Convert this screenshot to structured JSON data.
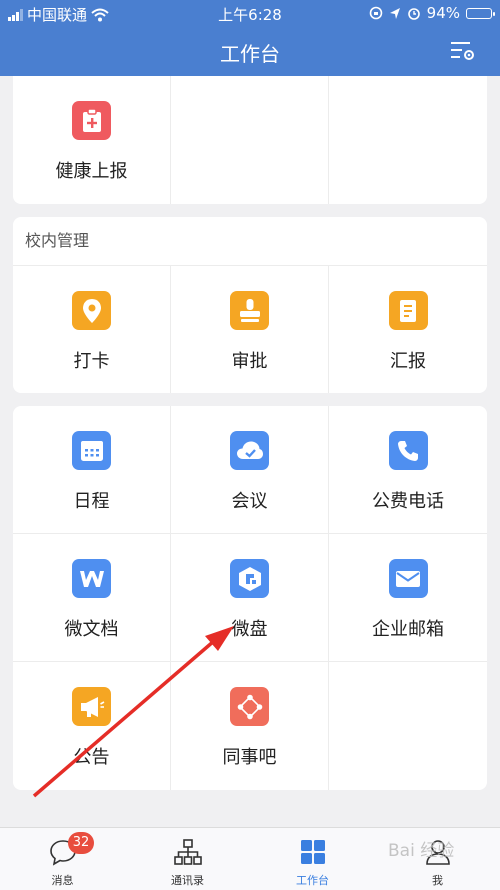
{
  "status_bar": {
    "carrier": "中国联通",
    "time": "上午6:28",
    "battery": "94%",
    "battery_level": 0.94
  },
  "nav": {
    "title": "工作台",
    "settings_icon": "list-settings-icon"
  },
  "section_top": {
    "items": [
      {
        "label": "健康上报",
        "icon": "clipboard-plus-icon",
        "color": "#ef5a5f"
      }
    ]
  },
  "section_campus": {
    "title": "校内管理",
    "items": [
      {
        "label": "打卡",
        "icon": "location-pin-icon",
        "color": "#f5a623"
      },
      {
        "label": "审批",
        "icon": "stamp-icon",
        "color": "#f5a623"
      },
      {
        "label": "汇报",
        "icon": "report-icon",
        "color": "#f5a623"
      }
    ]
  },
  "section_tools": {
    "items": [
      {
        "label": "日程",
        "icon": "calendar-icon",
        "color": "#4f8ff0"
      },
      {
        "label": "会议",
        "icon": "cloud-icon",
        "color": "#4f8ff0"
      },
      {
        "label": "公费电话",
        "icon": "phone-icon",
        "color": "#4f8ff0"
      },
      {
        "label": "微文档",
        "icon": "word-doc-icon",
        "color": "#4f8ff0"
      },
      {
        "label": "微盘",
        "icon": "drive-icon",
        "color": "#4f8ff0"
      },
      {
        "label": "企业邮箱",
        "icon": "mail-icon",
        "color": "#4f8ff0"
      },
      {
        "label": "公告",
        "icon": "megaphone-icon",
        "color": "#f5a623"
      },
      {
        "label": "同事吧",
        "icon": "share-nodes-icon",
        "color": "#f06d5b"
      }
    ]
  },
  "tabbar": {
    "tabs": [
      {
        "label": "消息",
        "icon": "chat-bubble-icon",
        "badge": "32"
      },
      {
        "label": "通讯录",
        "icon": "org-chart-icon"
      },
      {
        "label": "工作台",
        "icon": "grid-icon",
        "active": true
      },
      {
        "label": "我",
        "icon": "person-icon"
      }
    ]
  },
  "watermark": "Bai 经验"
}
